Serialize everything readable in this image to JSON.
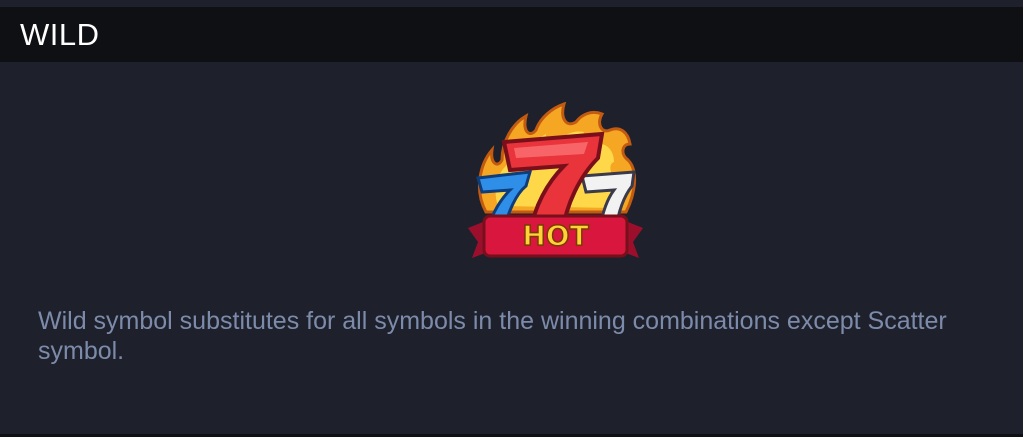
{
  "header": {
    "title": "WILD"
  },
  "symbol": {
    "icon": "hot-777-wild-icon",
    "label": "HOT",
    "digits": "777"
  },
  "description": {
    "text": "Wild symbol substitutes for all symbols in the winning combinations except Scatter symbol."
  },
  "colors": {
    "background": "#1e212b",
    "header_background": "#0f1014",
    "title_text": "#ffffff",
    "description_text": "#7d8bab",
    "flame": "#f5a623",
    "seven_red": "#e8343a",
    "seven_blue": "#2f8fe8",
    "ribbon": "#d8163e",
    "hot_text": "#ffd23a"
  }
}
